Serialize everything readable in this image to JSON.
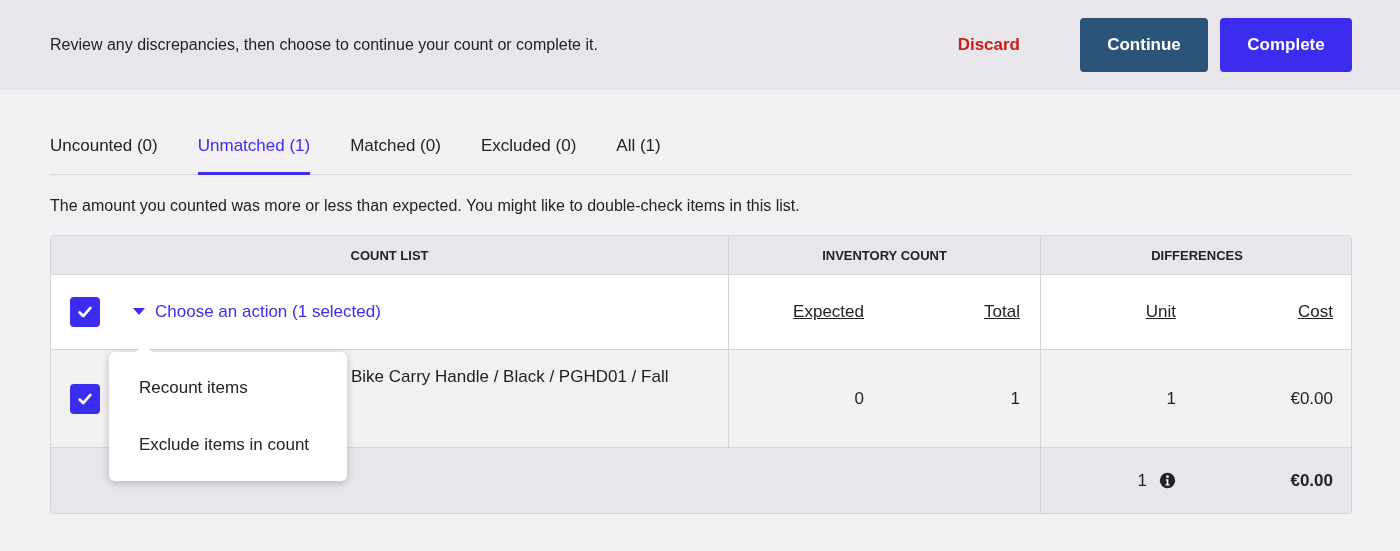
{
  "header": {
    "message": "Review any discrepancies, then choose to continue your count or complete it.",
    "buttons": [
      {
        "label": "Discard",
        "kind": "link"
      },
      {
        "label": "Continue",
        "kind": "secondary"
      },
      {
        "label": "Complete",
        "kind": "primary"
      }
    ]
  },
  "tabs": [
    {
      "label": "Uncounted (0)",
      "selected": false
    },
    {
      "label": "Unmatched (1)",
      "selected": true
    },
    {
      "label": "Matched (0)",
      "selected": false
    },
    {
      "label": "Excluded (0)",
      "selected": false
    },
    {
      "label": "All (1)",
      "selected": false
    }
  ],
  "description": "The amount you counted was more or less than expected. You might like to double-check items in this list.",
  "table": {
    "groups": [
      "COUNT LIST",
      "INVENTORY COUNT",
      "DIFFERENCES"
    ],
    "select_all": {
      "checked": true
    },
    "action": "Choose an action (1 selected)",
    "columns": [
      "Expected",
      "Total",
      "Unit",
      "Cost"
    ],
    "rows": [
      {
        "checked": true,
        "item": "Bike Carry Handle / Black / PGHD01 / Fall",
        "expected": "0",
        "total": "1",
        "unit": "1",
        "cost": "€0.00"
      }
    ],
    "footer": {
      "unit": "1",
      "cost": "€0.00"
    }
  },
  "action_menu": {
    "items": [
      "Recount items",
      "Exclude items in count"
    ]
  }
}
